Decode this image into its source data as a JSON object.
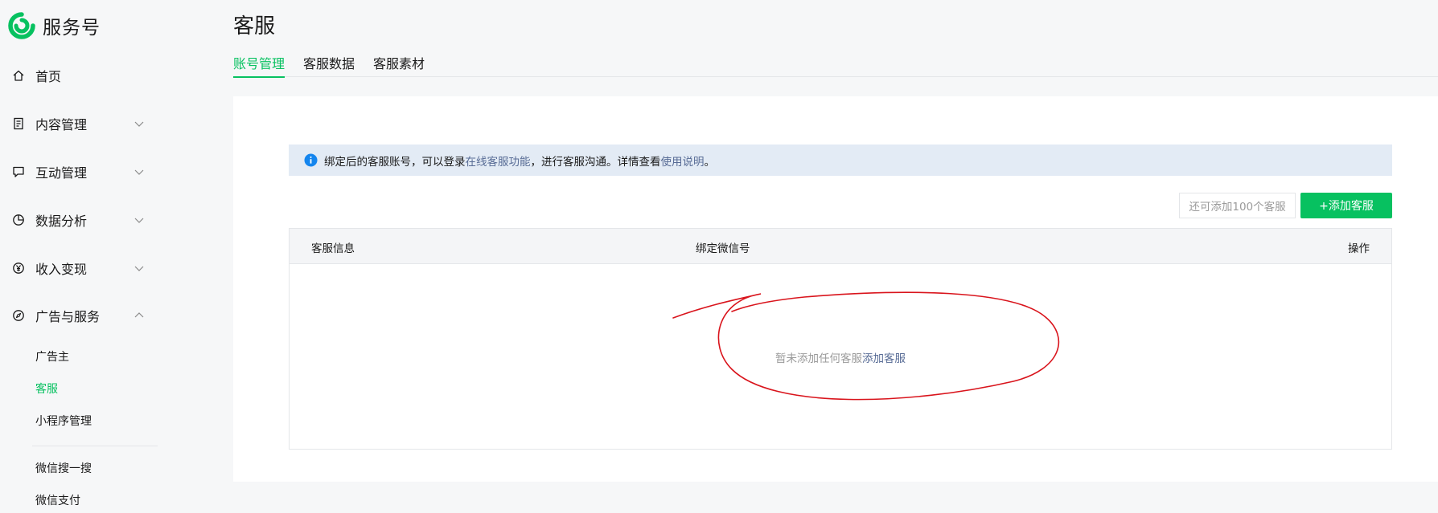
{
  "app": {
    "name": "服务号",
    "brand_color": "#07c160",
    "link_color": "#576b95"
  },
  "sidebar": {
    "items": [
      {
        "label": "首页",
        "icon": "home-icon",
        "expanded": null
      },
      {
        "label": "内容管理",
        "icon": "document-icon",
        "expanded": false
      },
      {
        "label": "互动管理",
        "icon": "comment-icon",
        "expanded": false
      },
      {
        "label": "数据分析",
        "icon": "pie-chart-icon",
        "expanded": false
      },
      {
        "label": "收入变现",
        "icon": "yen-icon",
        "expanded": false
      },
      {
        "label": "广告与服务",
        "icon": "compass-icon",
        "expanded": true
      }
    ],
    "subitems": [
      {
        "label": "广告主",
        "active": false
      },
      {
        "label": "客服",
        "active": true
      },
      {
        "label": "小程序管理",
        "active": false
      },
      {
        "label": "微信搜一搜",
        "active": false
      },
      {
        "label": "微信支付",
        "active": false
      }
    ]
  },
  "page": {
    "title": "客服",
    "tabs": [
      {
        "label": "账号管理",
        "active": true
      },
      {
        "label": "客服数据",
        "active": false
      },
      {
        "label": "客服素材",
        "active": false
      }
    ]
  },
  "notice": {
    "text_before": "绑定后的客服账号，可以登录",
    "link1": "在线客服功能",
    "text_middle": "，进行客服沟通。详情查看",
    "link2": "使用说明",
    "text_after": "。"
  },
  "toolbar": {
    "remaining": "还可添加100个客服",
    "add_button": "+添加客服"
  },
  "table": {
    "columns": [
      "客服信息",
      "绑定微信号",
      "操作"
    ],
    "empty_text": "暂未添加任何客服",
    "empty_link": "添加客服"
  },
  "annotation": {
    "type": "hand-drawn ellipse",
    "color": "#d9141c"
  }
}
